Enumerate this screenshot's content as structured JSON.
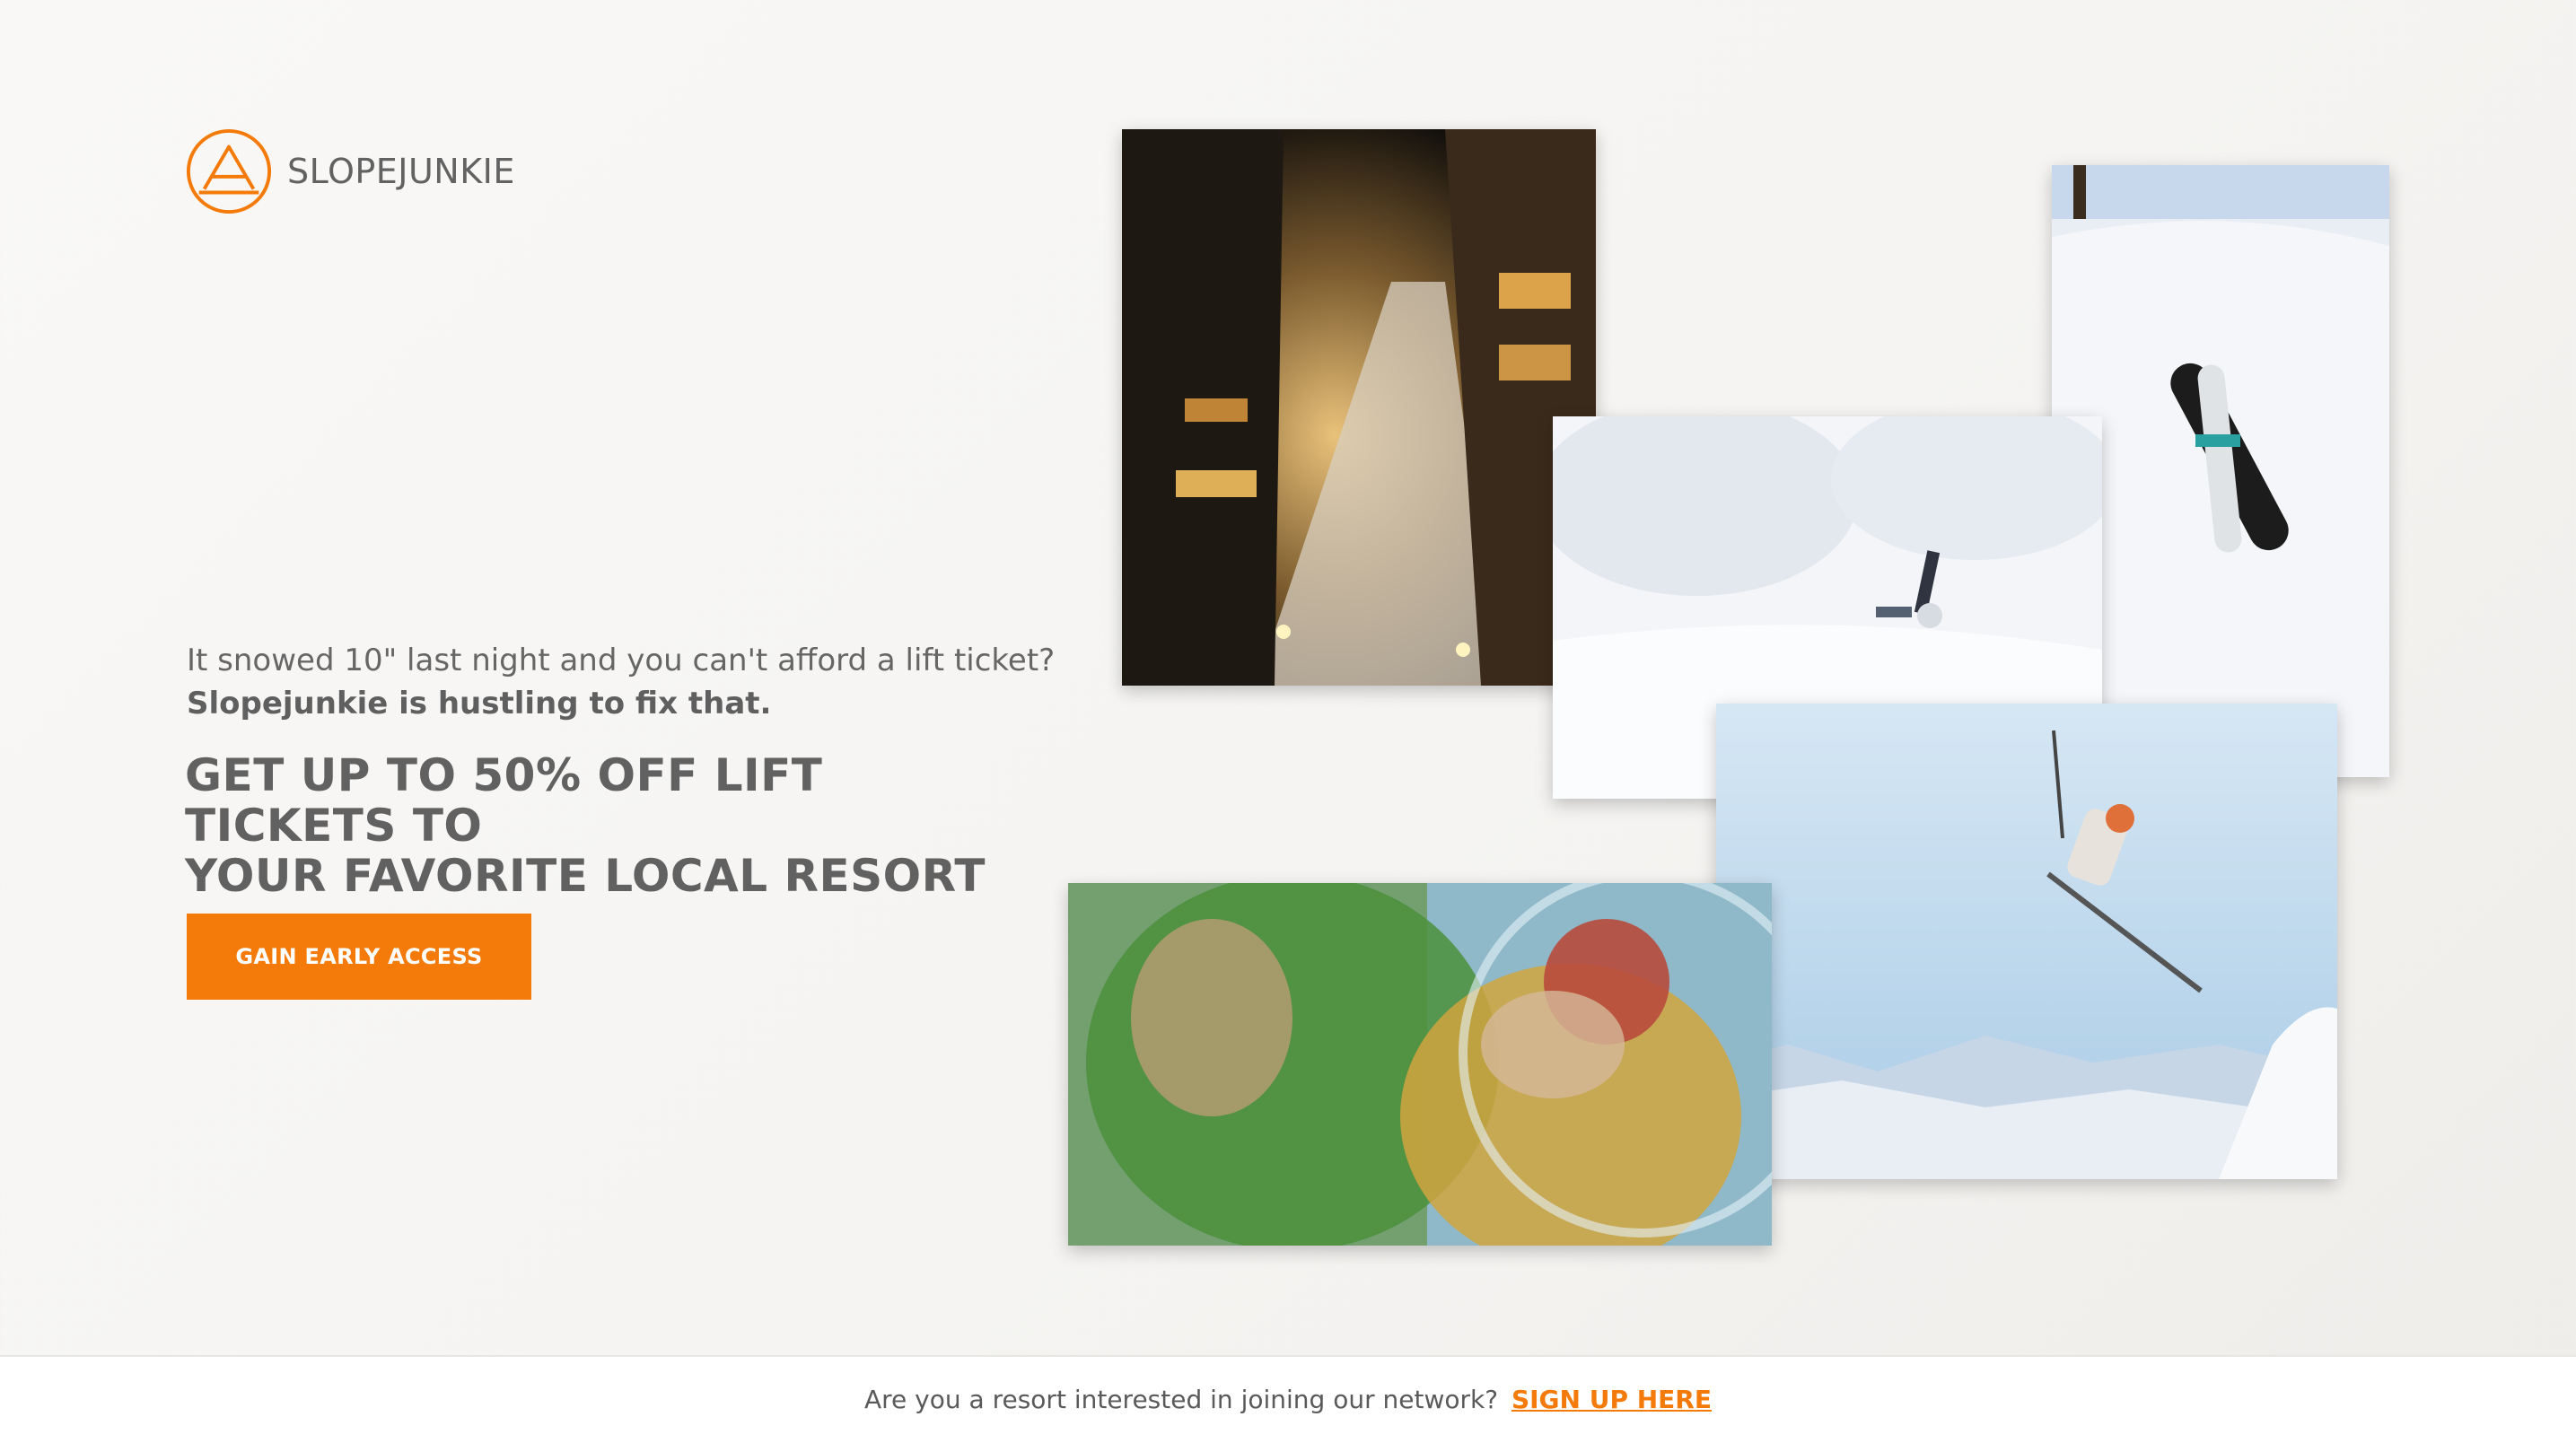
{
  "brand": {
    "name": "SLOPEJUNKIE",
    "accent_color": "#f47b0a",
    "logo_icon": "mountain-triangle-icon"
  },
  "hero": {
    "intro_line": "It snowed 10\" last night and you can't afford a lift ticket?",
    "intro_bold": "Slopejunkie is hustling to fix that.",
    "headline_line1": "GET UP TO 50% OFF LIFT TICKETS TO",
    "headline_line2": "YOUR FAVORITE LOCAL RESORT",
    "cta_label": "GAIN EARLY ACCESS"
  },
  "gallery": [
    {
      "subject": "night ski village street"
    },
    {
      "subject": "snowboard in deep snow"
    },
    {
      "subject": "skier buried in powder"
    },
    {
      "subject": "freestyle skier jumping"
    },
    {
      "subject": "skiers with goggles close-up"
    }
  ],
  "footer": {
    "question": "Are you a resort interested in joining our network?",
    "link_label": "SIGN UP HERE"
  }
}
